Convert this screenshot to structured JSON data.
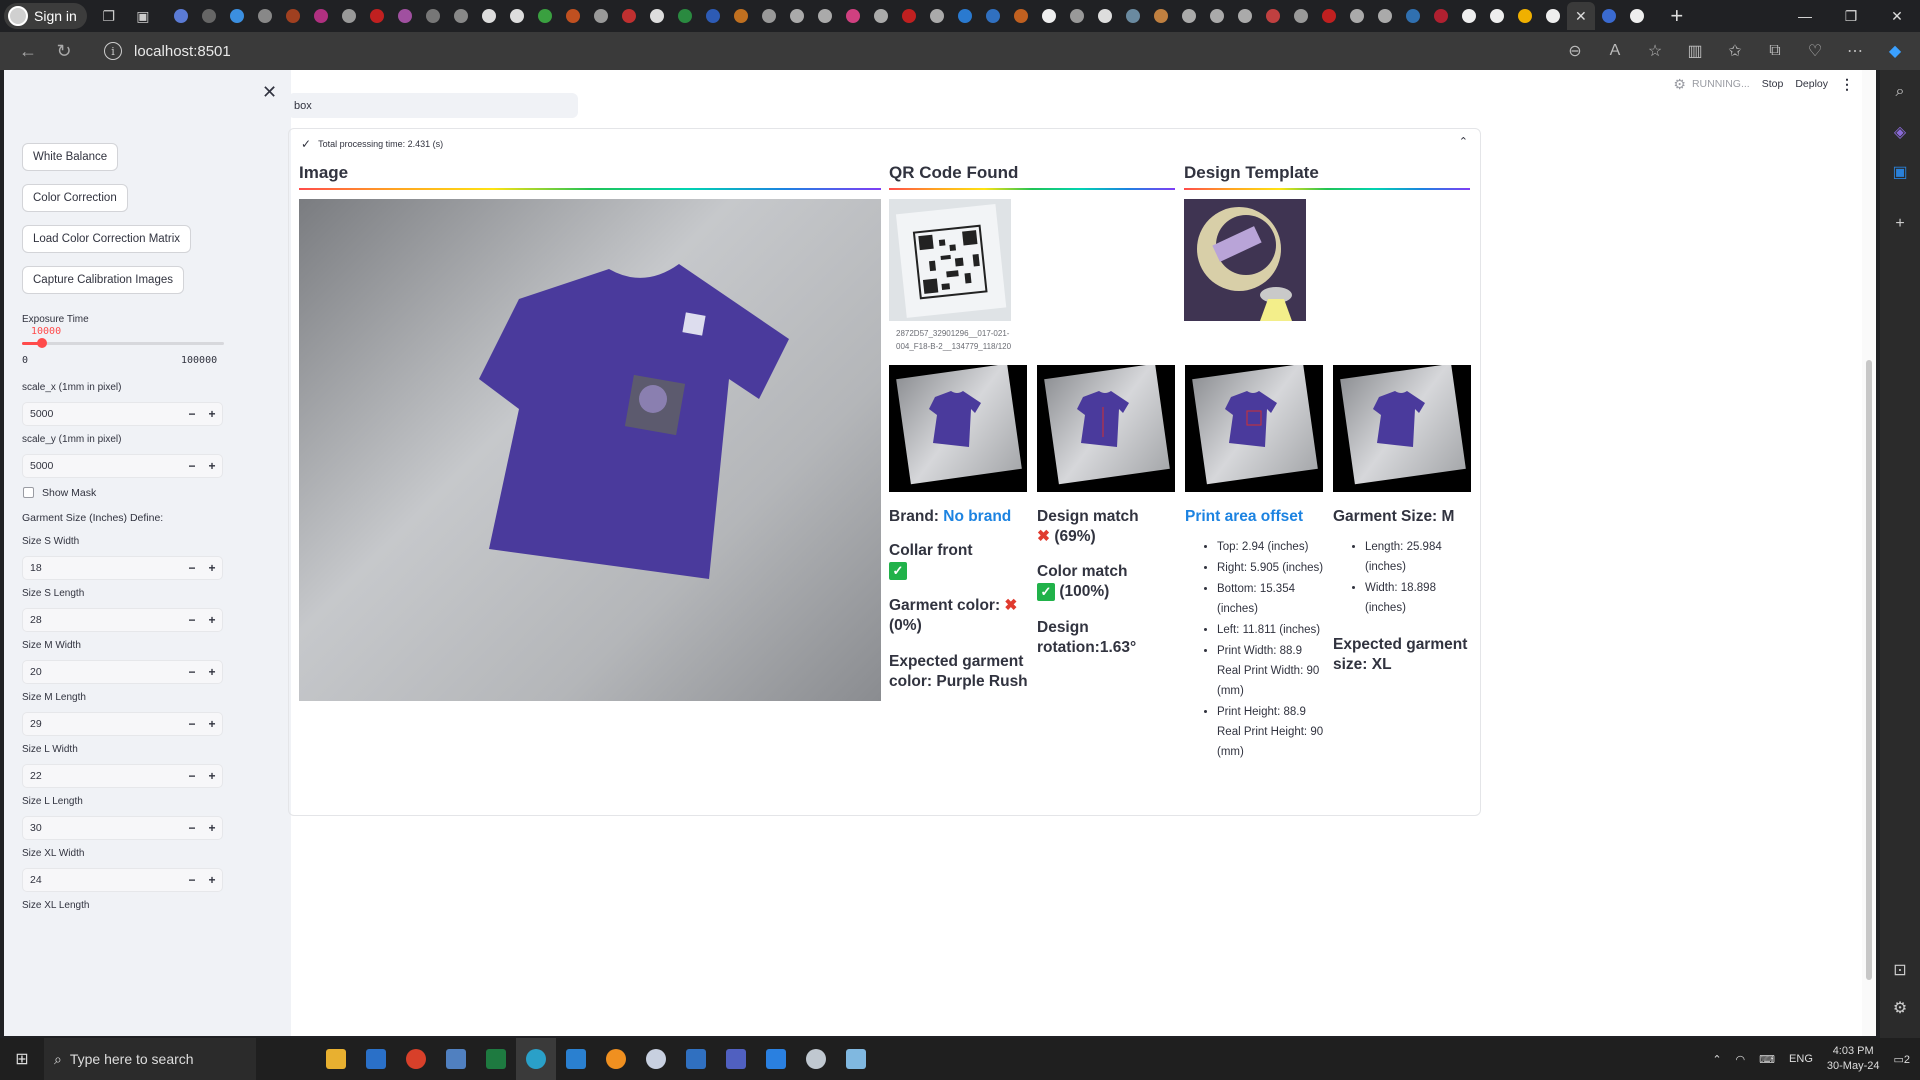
{
  "browser": {
    "profile_label": "Sign in",
    "url": "localhost:8501"
  },
  "app_status": {
    "running_label": "RUNNING...",
    "stop_label": "Stop",
    "deploy_label": "Deploy"
  },
  "sidebar": {
    "buttons": {
      "white_balance": "White Balance",
      "color_correction": "Color Correction",
      "load_matrix": "Load Color Correction Matrix",
      "capture_calibration": "Capture Calibration Images"
    },
    "exposure": {
      "label": "Exposure Time",
      "value": "10000",
      "min": "0",
      "max": "100000",
      "fraction": 0.1
    },
    "scale_x": {
      "label": "scale_x (1mm in pixel)",
      "value": "5000"
    },
    "scale_y": {
      "label": "scale_y (1mm in pixel)",
      "value": "5000"
    },
    "show_mask_label": "Show Mask",
    "garment_size_header": "Garment Size (Inches) Define:",
    "sizes": [
      {
        "label": "Size S Width",
        "value": "18"
      },
      {
        "label": "Size S Length",
        "value": "28"
      },
      {
        "label": "Size M Width",
        "value": "20"
      },
      {
        "label": "Size M Length",
        "value": "29"
      },
      {
        "label": "Size L Width",
        "value": "22"
      },
      {
        "label": "Size L Length",
        "value": "30"
      },
      {
        "label": "Size XL Width",
        "value": "24"
      },
      {
        "label": "Size XL Length",
        "value": ""
      }
    ]
  },
  "search": {
    "value": "box"
  },
  "expander": {
    "status": "Total processing time: 2.431 (s)"
  },
  "columns": {
    "image": "Image",
    "qr_found": "QR Code Found",
    "design_template": "Design Template"
  },
  "qr_caption": "2872D57_32901296__017-021-004_F18-B-2__134779_118/120",
  "results": {
    "brand_label": "Brand: ",
    "brand_value": "No brand",
    "collar_front": "Collar front",
    "garment_color_label": "Garment color: ",
    "garment_color_value": "(0%)",
    "expected_color": "Expected garment color: Purple Rush",
    "design_match_label": "Design match",
    "design_match_value": "(69%)",
    "color_match_label": "Color match",
    "color_match_value": "(100%)",
    "design_rotation": "Design rotation:1.63°",
    "print_area_offset": "Print area offset",
    "offsets": [
      "Top: 2.94 (inches)",
      "Right: 5.905 (inches)",
      "Bottom: 15.354 (inches)",
      "Left: 11.811 (inches)",
      "Print Width: 88.9 Real Print Width: 90 (mm)",
      "Print Height: 88.9 Real Print Height: 90 (mm)"
    ],
    "garment_size": "Garment Size: M",
    "size_items": [
      "Length: 25.984 (inches)",
      "Width: 18.898 (inches)"
    ],
    "expected_size": "Expected garment size: XL"
  },
  "taskbar": {
    "search_placeholder": "Type here to search",
    "language": "ENG",
    "time": "4:03 PM",
    "date": "30-May-24",
    "notifications": "2"
  },
  "colors": {
    "accent": "#ff4b4b",
    "link_blue": "#1c83e1",
    "shirt_purple": "#4a3a9c"
  }
}
